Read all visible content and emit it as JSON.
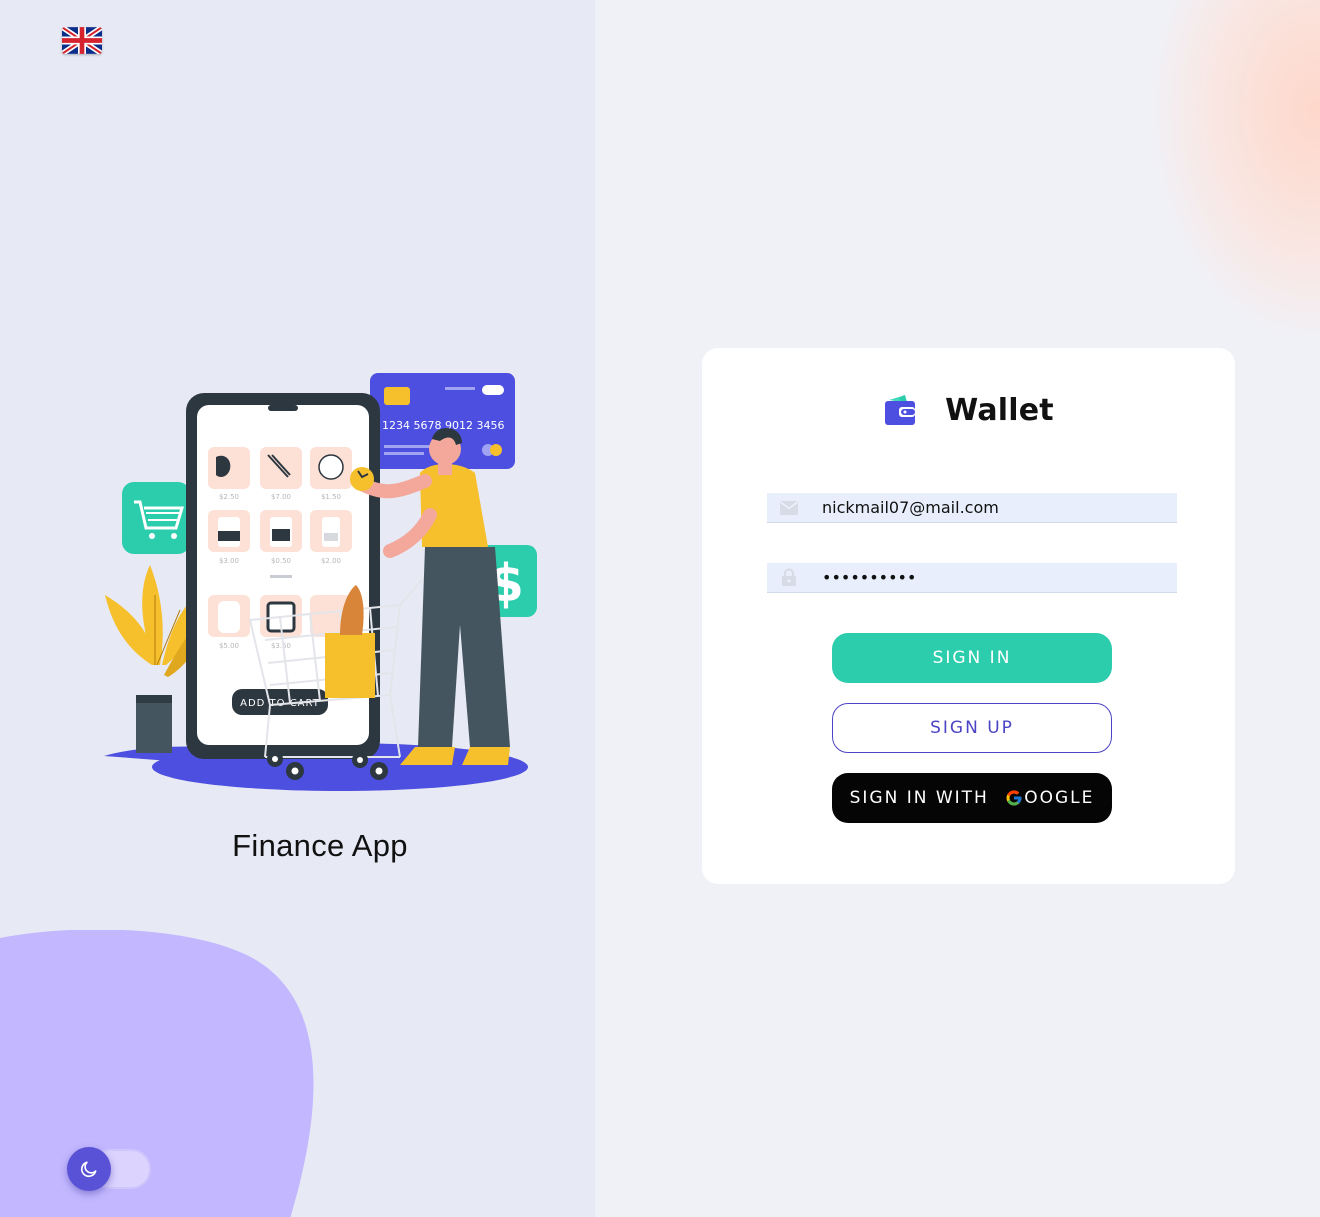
{
  "language": {
    "flag": "uk-flag-icon"
  },
  "left": {
    "app_title": "Finance App",
    "illustration": {
      "card_number": "1234  5678  9012  3456",
      "add_to_cart": "ADD TO CART",
      "prices": [
        "$2.50",
        "$7.00",
        "$1.50",
        "$3.00",
        "$0.50",
        "$2.00",
        "$5.00",
        "$3.50"
      ]
    }
  },
  "card": {
    "brand_name": "Wallet",
    "email": {
      "value": "nickmail07@mail.com",
      "icon": "mail-icon"
    },
    "password": {
      "value": "••••••••••",
      "icon": "lock-icon"
    },
    "buttons": {
      "sign_in": "SIGN IN",
      "sign_up": "SIGN UP",
      "google_prefix": "SIGN IN WITH ",
      "google_suffix": "OOGLE"
    }
  },
  "theme_toggle": {
    "icon": "moon-icon",
    "mode": "light"
  },
  "colors": {
    "accent_green": "#2ccdac",
    "accent_indigo": "#4b44c4",
    "blob_purple": "#c3b8ff",
    "left_bg": "#e7e9f4",
    "right_bg": "#f0f1f7"
  }
}
